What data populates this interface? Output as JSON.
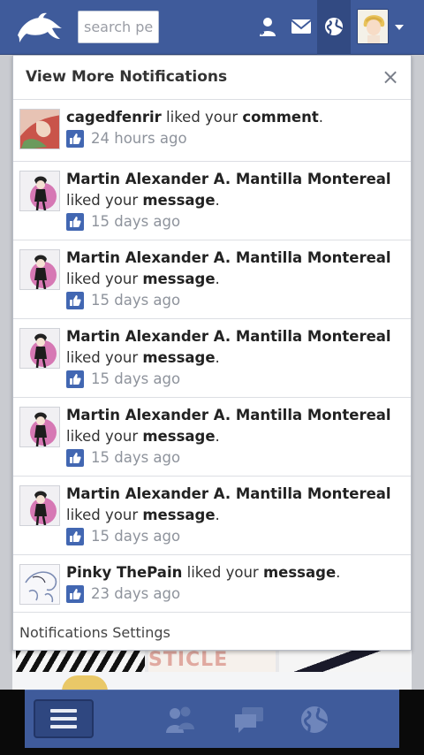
{
  "topbar": {
    "search_placeholder": "search pe",
    "icons": [
      "dolphin-logo-icon",
      "friend-requests-icon",
      "messages-icon",
      "notifications-globe-icon",
      "user-avatar",
      "chevron-down-icon"
    ],
    "active_icon": "notifications-globe-icon"
  },
  "panel": {
    "title": "View More Notifications",
    "close_glyph": "×",
    "notifications": [
      {
        "actor": "cagedfenrir",
        "verb": " liked your ",
        "object": "comment",
        "end": ".",
        "time": "24 hours ago",
        "avatar": "anime-red-avatar"
      },
      {
        "actor": "Martin Alexander A. Mantilla Montereal",
        "verb": "liked your ",
        "object": "message",
        "end": ".",
        "time": "15 days ago",
        "avatar": "pink-circle-figure-avatar"
      },
      {
        "actor": "Martin Alexander A. Mantilla Montereal",
        "verb": "liked your ",
        "object": "message",
        "end": ".",
        "time": "15 days ago",
        "avatar": "pink-circle-figure-avatar"
      },
      {
        "actor": "Martin Alexander A. Mantilla Montereal",
        "verb": "liked your ",
        "object": "message",
        "end": ".",
        "time": "15 days ago",
        "avatar": "pink-circle-figure-avatar"
      },
      {
        "actor": "Martin Alexander A. Mantilla Montereal",
        "verb": "liked your ",
        "object": "message",
        "end": ".",
        "time": "15 days ago",
        "avatar": "pink-circle-figure-avatar"
      },
      {
        "actor": "Martin Alexander A. Mantilla Montereal",
        "verb": "liked your ",
        "object": "message",
        "end": ".",
        "time": "15 days ago",
        "avatar": "pink-circle-figure-avatar"
      },
      {
        "actor": "Pinky ThePain",
        "verb": " liked your ",
        "object": "message",
        "end": ".",
        "time": "23 days ago",
        "avatar": "sketch-avatar"
      }
    ],
    "settings_label": "Notifications Settings"
  },
  "background": {
    "strip_text": "STICLE TEABA"
  },
  "bottombar": {
    "icons": [
      "menu-icon",
      "friends-icon",
      "chat-icon",
      "globe-icon"
    ]
  },
  "colors": {
    "brand_blue": "#3f5b9b",
    "like_blue": "#4267b2",
    "timestamp_gray": "#8e939c"
  }
}
